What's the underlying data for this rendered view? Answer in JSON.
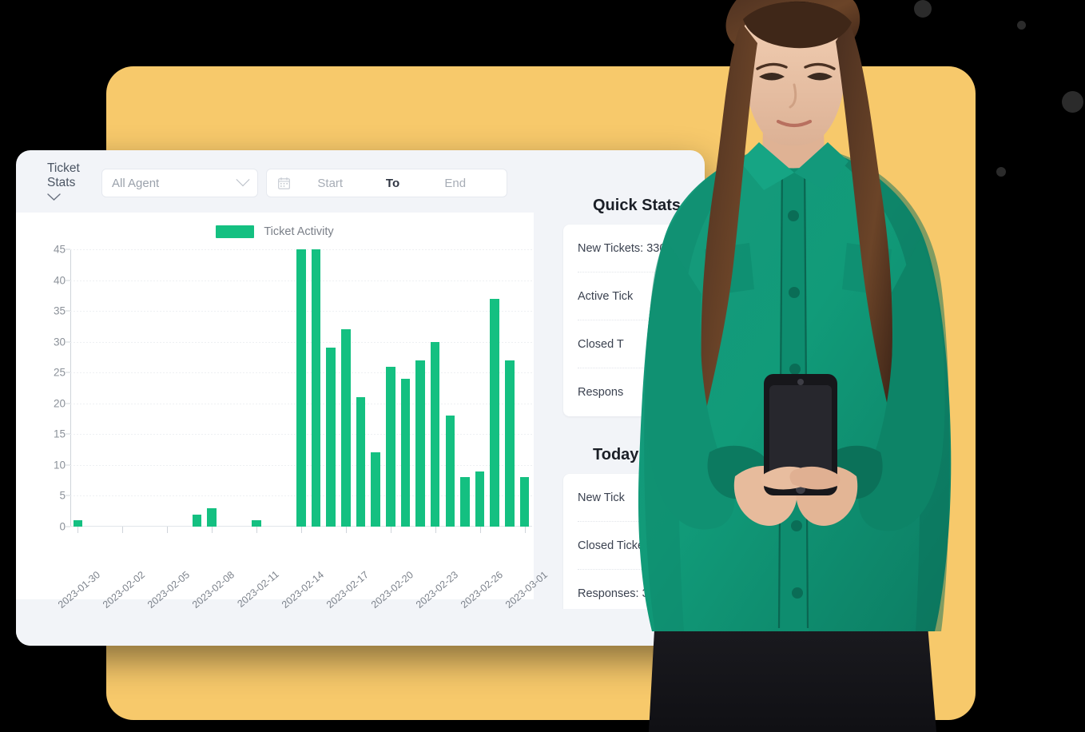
{
  "theme": {
    "background": "#000000",
    "accent_card": "#f7c96b",
    "bar_color": "#14c081",
    "panel_bg": "#f2f4f8",
    "dot_color": "#2b2b2b"
  },
  "toolbar": {
    "stats_label": "Ticket Stats",
    "stats_chevron": "chevron-down",
    "agent_select": {
      "value": "All Agent",
      "placeholder": "All Agent"
    },
    "date_range": {
      "calendar_icon": "calendar-icon",
      "start_placeholder": "Start",
      "separator": "To",
      "end_placeholder": "End"
    }
  },
  "chart_data": {
    "type": "bar",
    "title": "",
    "legend": [
      "Ticket Activity"
    ],
    "legend_position": "top-center",
    "xlabel": "",
    "ylabel": "",
    "ylim": [
      0,
      45
    ],
    "yticks": [
      0,
      5,
      10,
      15,
      20,
      25,
      30,
      35,
      40,
      45
    ],
    "grid": true,
    "xtick_labels": [
      "2023-01-30",
      "2023-02-02",
      "2023-02-05",
      "2023-02-08",
      "2023-02-11",
      "2023-02-14",
      "2023-02-17",
      "2023-02-20",
      "2023-02-23",
      "2023-02-26",
      "2023-03-01"
    ],
    "xtick_every": 3,
    "categories": [
      "2023-01-30",
      "2023-01-31",
      "2023-02-01",
      "2023-02-02",
      "2023-02-03",
      "2023-02-04",
      "2023-02-05",
      "2023-02-06",
      "2023-02-07",
      "2023-02-08",
      "2023-02-09",
      "2023-02-10",
      "2023-02-11",
      "2023-02-12",
      "2023-02-13",
      "2023-02-14",
      "2023-02-15",
      "2023-02-16",
      "2023-02-17",
      "2023-02-18",
      "2023-02-19",
      "2023-02-20",
      "2023-02-21",
      "2023-02-22",
      "2023-02-23",
      "2023-02-24",
      "2023-02-25",
      "2023-02-26",
      "2023-02-27",
      "2023-02-28",
      "2023-03-01"
    ],
    "series": [
      {
        "name": "Ticket Activity",
        "color": "#14c081",
        "values": [
          1,
          0,
          0,
          0,
          0,
          0,
          0,
          0,
          2,
          3,
          0,
          0,
          1,
          0,
          0,
          45,
          45,
          29,
          32,
          21,
          12,
          26,
          24,
          27,
          30,
          18,
          8,
          9,
          37,
          27,
          8
        ]
      }
    ]
  },
  "right_panel": {
    "quick_stats": {
      "title": "Quick Stats",
      "rows": [
        "New Tickets: 330",
        "Active Tick",
        "Closed T",
        "Respons"
      ]
    },
    "today": {
      "title": "Today",
      "rows": [
        "New Tick",
        "Closed Tickets: 0",
        "Responses: 3"
      ]
    }
  }
}
